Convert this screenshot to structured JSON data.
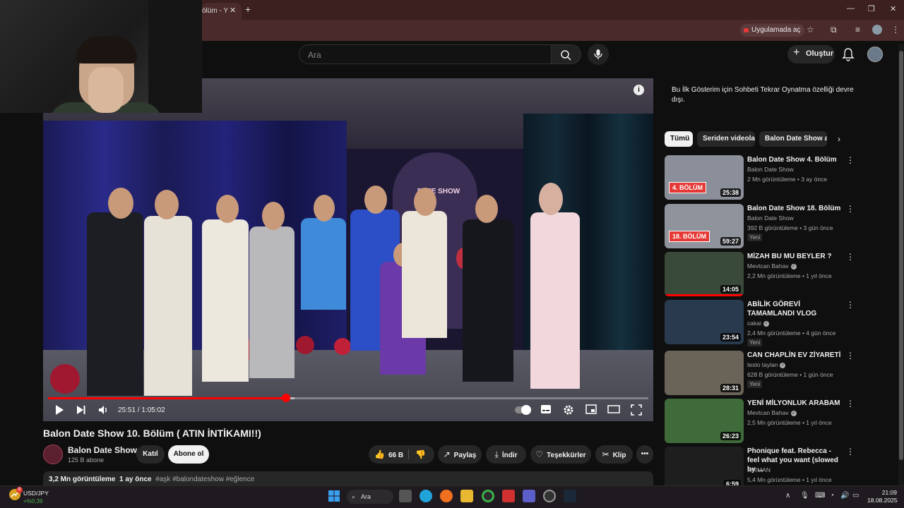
{
  "browser": {
    "tab_title": "ölüm - Y",
    "tab_close": "✕",
    "new_tab": "+",
    "window_min": "—",
    "window_max": "❐",
    "window_close": "✕",
    "open_in_app": "Uygulamada aç"
  },
  "header": {
    "search_placeholder": "Ara",
    "create_label": "Oluştur",
    "create_icon": "+"
  },
  "player": {
    "time_current": "25:51",
    "time_total": "1:05:02",
    "time_separator": " / ",
    "progress_fraction": 0.397,
    "buffer_fraction": 0.41,
    "sign_text": "DATE SHOW",
    "info_icon": "i"
  },
  "video": {
    "title": "Balon Date Show 10. Bölüm ( ATIN İNTİKAMI!!)",
    "channel_name": "Balon Date Show",
    "channel_subs": "125 B abone",
    "join_label": "Katıl",
    "subscribe_label": "Abone ol",
    "likes": "66 B",
    "share_label": "Paylaş",
    "download_label": "İndir",
    "thanks_label": "Teşekkürler",
    "clip_label": "Klip",
    "more": "•••",
    "views": "3,2 Mn görüntüleme",
    "age": "1 ay önce",
    "tags": "#aşk #balondateshow #eğlence"
  },
  "sidebar": {
    "notice": "Bu İlk Gösterim için Sohbeti Tekrar Oynatma özelliği devre dışı.",
    "chips": [
      "Tümü",
      "Seriden videolar",
      "Balon Date Show adl"
    ],
    "chip_next": "›",
    "kebab": "⋮",
    "new_label": "Yeni",
    "recommendations": [
      {
        "title": "Balon Date Show 4. Bölüm",
        "channel": "Balon Date Show",
        "meta": "2 Mn görüntüleme • 3 ay önce",
        "duration": "25:38",
        "badge": "4. BÖLÜM",
        "verified": false,
        "is_new": false,
        "thumb_color": "#8a8f99"
      },
      {
        "title": "Balon Date Show 18. Bölüm",
        "channel": "Balon Date Show",
        "meta": "392 B görüntüleme • 3 gün önce",
        "duration": "59:27",
        "badge": "18. BÖLÜM",
        "verified": false,
        "is_new": true,
        "thumb_color": "#8f949c"
      },
      {
        "title": "MİZAH BU MU BEYLER ?",
        "channel": "Mevtcan Bahav",
        "meta": "2,2 Mn görüntüleme • 1 yıl önce",
        "duration": "14:05",
        "badge": "",
        "verified": true,
        "is_new": false,
        "thumb_color": "#3a4a3a",
        "watched": 1.0
      },
      {
        "title": "ABİLİK GÖREVİ TAMAMLANDI VLOG",
        "channel": "cakai",
        "meta": "2,4 Mn görüntüleme • 4 gün önce",
        "duration": "23:54",
        "badge": "",
        "verified": true,
        "is_new": true,
        "thumb_color": "#2a3a4e"
      },
      {
        "title": "CAN CHAPLİN EV ZİYARETİ",
        "channel": "testo taylan",
        "meta": "628 B görüntüleme • 1 gün önce",
        "duration": "28:31",
        "badge": "",
        "verified": true,
        "is_new": true,
        "thumb_color": "#6a6458"
      },
      {
        "title": "YENİ MİLYONLUK ARABAM",
        "channel": "Mevtcan Bahav",
        "meta": "2,5 Mn görüntüleme • 1 yıl önce",
        "duration": "26:23",
        "badge": "",
        "verified": true,
        "is_new": false,
        "thumb_color": "#3f6a3a"
      },
      {
        "title": "Phonique feat. Rebecca - feel what you want (slowed by ...",
        "channel": "KIRMAN",
        "meta": "5,4 Mn görüntüleme • 1 yıl önce",
        "duration": "6:59",
        "badge": "",
        "verified": false,
        "is_new": false,
        "thumb_color": "#1e1e1e"
      }
    ]
  },
  "taskbar": {
    "ticker_label": "USD/JPY",
    "ticker_value": "+%0,39",
    "ticker_badge": "8",
    "search_label": "Ara",
    "tray_caret": "∧",
    "time": "21:09",
    "date": "18.08.2025"
  },
  "colors": {
    "accent_red": "#ff0000",
    "background": "#0f0f0f",
    "chrome_tab_bar": "#3c1f1f",
    "chip_bg": "#272727"
  }
}
